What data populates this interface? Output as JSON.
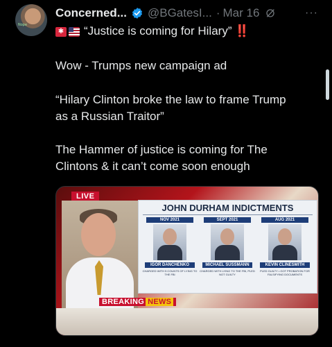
{
  "author": {
    "display_name": "Concerned...",
    "handle": "@BGatesI...",
    "separator": "·",
    "date": "Mar 16",
    "avatar_caption": "Nope"
  },
  "tweet": {
    "line1": "“Justice is coming for Hilary”",
    "line1_suffix": "‼️",
    "line2": "Wow - Trumps new campaign ad",
    "line3": "“Hilary Clinton broke the law to frame Trump",
    "line4": "as a Russian Traitor”",
    "line5": "The Hammer of justice is coming for The",
    "line6": "Clintons & it can’t come soon enough"
  },
  "more_label": "···",
  "video": {
    "live": "LIVE",
    "panel_title": "JOHN DURHAM INDICTMENTS",
    "columns": [
      {
        "month": "NOV 2021",
        "name": "IGOR DANCHENKO",
        "desc": "CHARGED WITH 5 COUNTS OF LYING TO THE FBI"
      },
      {
        "month": "SEPT 2021",
        "name": "MICHAEL SUSSMANN",
        "desc": "CHARGED WITH LYING TO THE FBI, PLED NOT GUILTY"
      },
      {
        "month": "AUG 2021",
        "name": "KEVIN CLINESMITH",
        "desc": "PLED GUILTY • GOT PROBATION FOR FALSIFYING DOCUMENTS"
      }
    ],
    "breaking": "BREAKING",
    "news": "NEWS"
  },
  "colors": {
    "background": "#000000",
    "text": "#e7e9ea",
    "muted": "#71767b",
    "verified": "#1d9bf0",
    "live_red": "#c8102e"
  }
}
